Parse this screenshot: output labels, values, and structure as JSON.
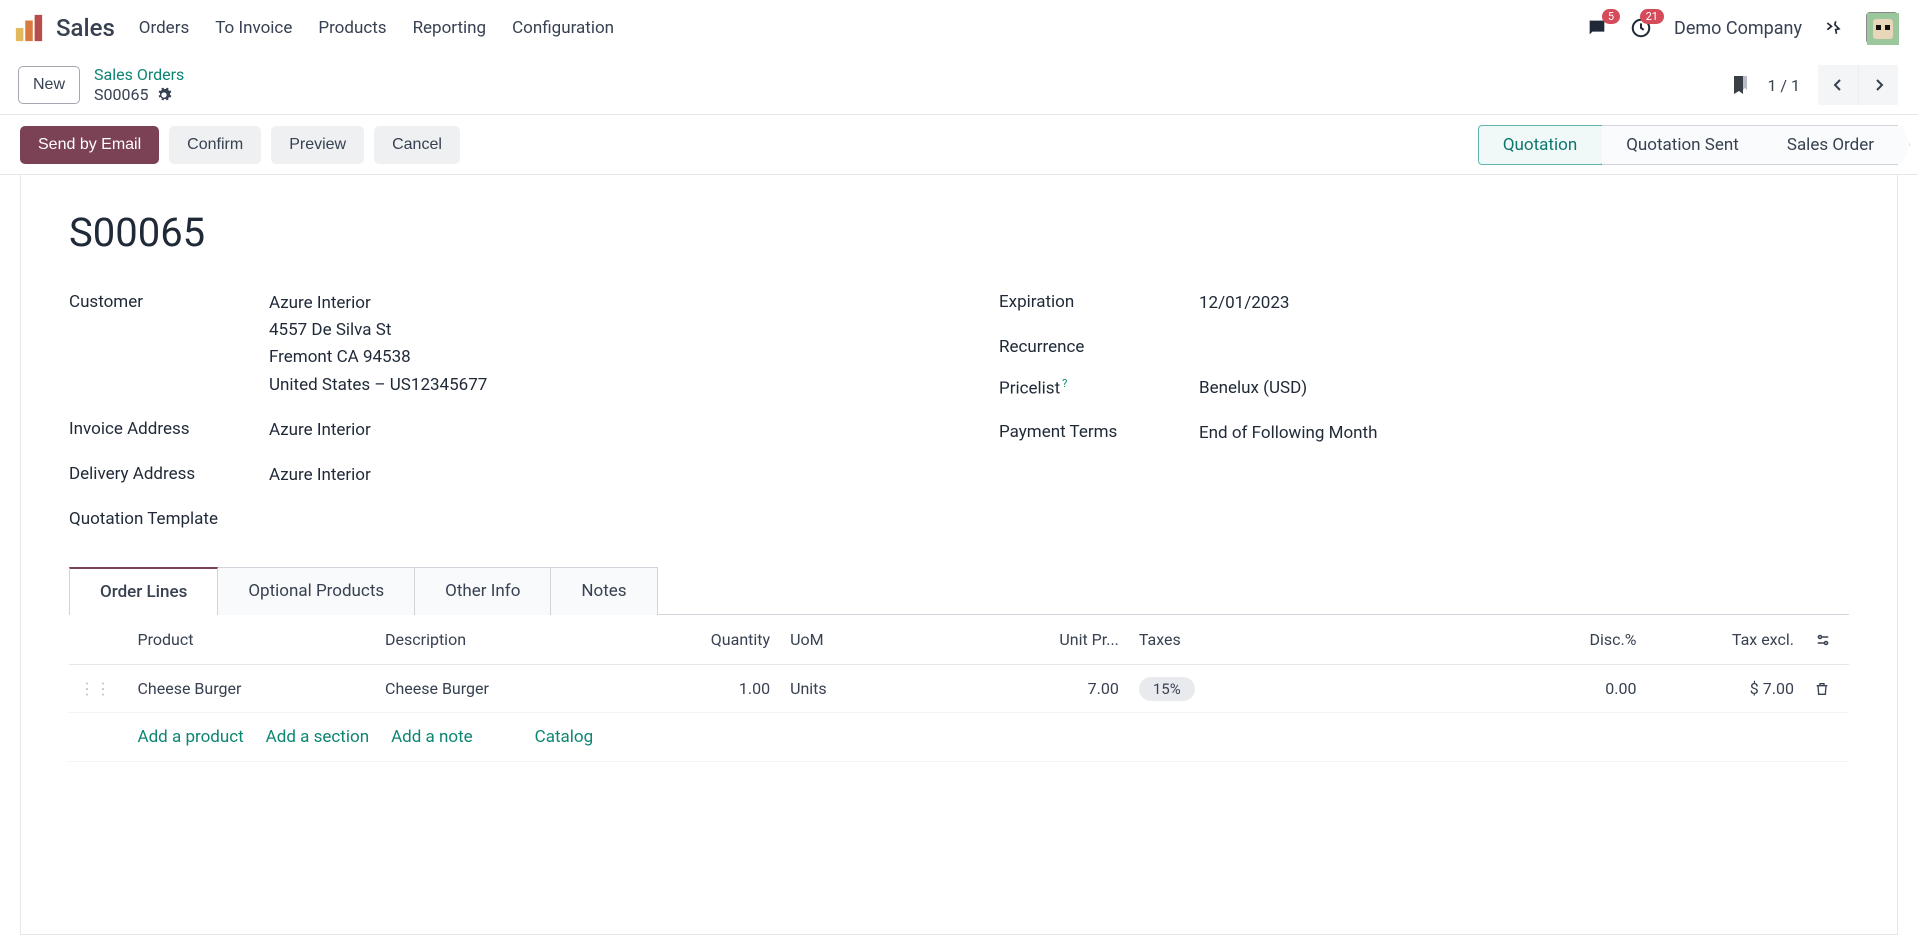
{
  "header": {
    "app": "Sales",
    "menu": [
      "Orders",
      "To Invoice",
      "Products",
      "Reporting",
      "Configuration"
    ],
    "chat_badge": "5",
    "clock_badge": "21",
    "company": "Demo Company"
  },
  "control": {
    "new": "New",
    "breadcrumb_parent": "Sales Orders",
    "breadcrumb_current": "S00065",
    "pager": "1 / 1"
  },
  "actions": {
    "send_email": "Send by Email",
    "confirm": "Confirm",
    "preview": "Preview",
    "cancel": "Cancel",
    "status": [
      "Quotation",
      "Quotation Sent",
      "Sales Order"
    ]
  },
  "record": {
    "title": "S00065",
    "left": {
      "customer_label": "Customer",
      "customer_name": "Azure Interior",
      "customer_street": "4557 De Silva St",
      "customer_city": "Fremont CA 94538",
      "customer_country": "United States – US12345677",
      "invoice_label": "Invoice Address",
      "invoice_value": "Azure Interior",
      "delivery_label": "Delivery Address",
      "delivery_value": "Azure Interior",
      "template_label": "Quotation Template"
    },
    "right": {
      "expiration_label": "Expiration",
      "expiration_value": "12/01/2023",
      "recurrence_label": "Recurrence",
      "pricelist_label": "Pricelist",
      "pricelist_value": "Benelux (USD)",
      "payment_label": "Payment Terms",
      "payment_value": "End of Following Month"
    }
  },
  "tabs": [
    "Order Lines",
    "Optional Products",
    "Other Info",
    "Notes"
  ],
  "table": {
    "headers": {
      "product": "Product",
      "description": "Description",
      "quantity": "Quantity",
      "uom": "UoM",
      "unit_price": "Unit Pr...",
      "taxes": "Taxes",
      "disc": "Disc.%",
      "tax_excl": "Tax excl."
    },
    "row": {
      "product": "Cheese Burger",
      "description": "Cheese Burger",
      "quantity": "1.00",
      "uom": "Units",
      "unit_price": "7.00",
      "tax": "15%",
      "disc": "0.00",
      "tax_excl": "$ 7.00"
    },
    "add": {
      "product": "Add a product",
      "section": "Add a section",
      "note": "Add a note",
      "catalog": "Catalog"
    }
  }
}
